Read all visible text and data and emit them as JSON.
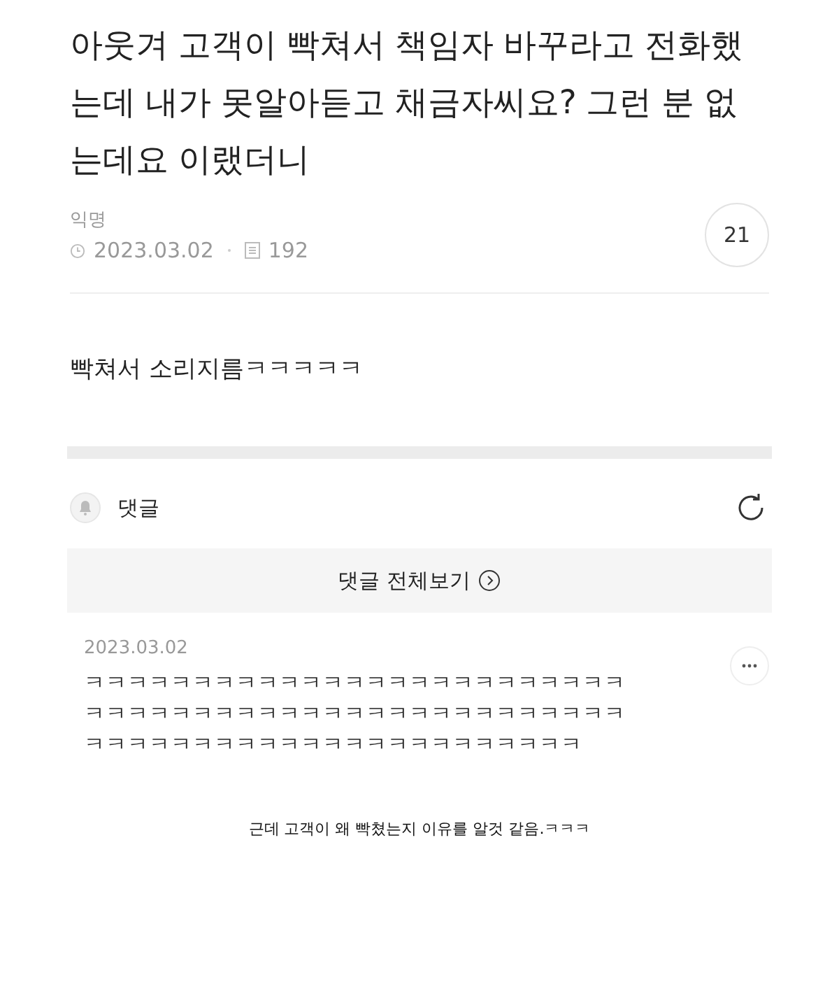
{
  "post": {
    "title": "아웃겨 고객이 빡쳐서 책임자 바꾸라고 전화했는데 내가 못알아듣고 채금자씨요? 그런 분 없는데요 이랬더니",
    "author": "익명",
    "date": "2023.03.02",
    "views": "192",
    "comment_count": "21",
    "body": "빡쳐서 소리지름ㅋㅋㅋㅋㅋ"
  },
  "comments_header": {
    "label": "댓글",
    "view_all": "댓글 전체보기"
  },
  "comments": [
    {
      "date": "2023.03.02",
      "lines": [
        "ㅋㅋㅋㅋㅋㅋㅋㅋㅋㅋㅋㅋㅋㅋㅋㅋㅋㅋㅋㅋㅋㅋㅋㅋㅋ",
        "ㅋㅋㅋㅋㅋㅋㅋㅋㅋㅋㅋㅋㅋㅋㅋㅋㅋㅋㅋㅋㅋㅋㅋㅋㅋ",
        "ㅋㅋㅋㅋㅋㅋㅋㅋㅋㅋㅋㅋㅋㅋㅋㅋㅋㅋㅋㅋㅋㅋㅋ"
      ]
    }
  ],
  "caption": "근데 고객이 왜 빡쳤는지 이유를 알것 같음.ㅋㅋㅋ"
}
